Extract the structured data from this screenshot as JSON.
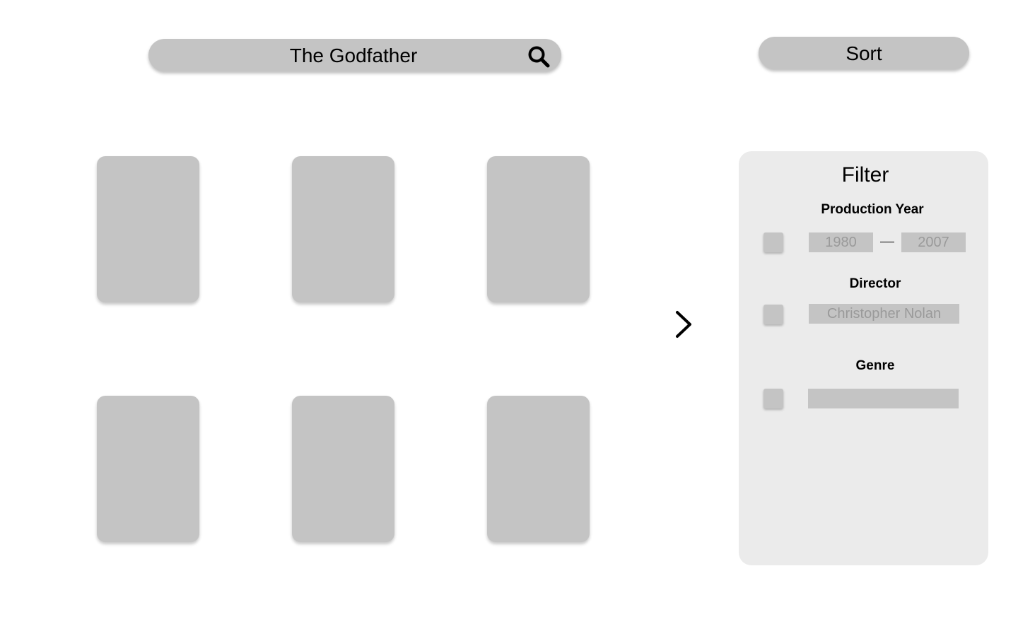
{
  "search": {
    "value": "The Godfather",
    "icon": "search-icon"
  },
  "sort": {
    "label": "Sort"
  },
  "results": {
    "cards": [
      {
        "row": 1,
        "col": 1
      },
      {
        "row": 1,
        "col": 2
      },
      {
        "row": 1,
        "col": 3
      },
      {
        "row": 2,
        "col": 1
      },
      {
        "row": 2,
        "col": 2
      },
      {
        "row": 2,
        "col": 3
      }
    ],
    "next_icon": "chevron-right-icon"
  },
  "filter": {
    "title": "Filter",
    "production_year": {
      "label": "Production Year",
      "from": "1980",
      "to": "2007"
    },
    "director": {
      "label": "Director",
      "placeholder": "Christopher Nolan"
    },
    "genre": {
      "label": "Genre",
      "value": ""
    }
  },
  "colors": {
    "control_gray": "#c4c4c4",
    "panel_gray": "#ebebeb",
    "placeholder_gray": "#9a9a9a"
  }
}
